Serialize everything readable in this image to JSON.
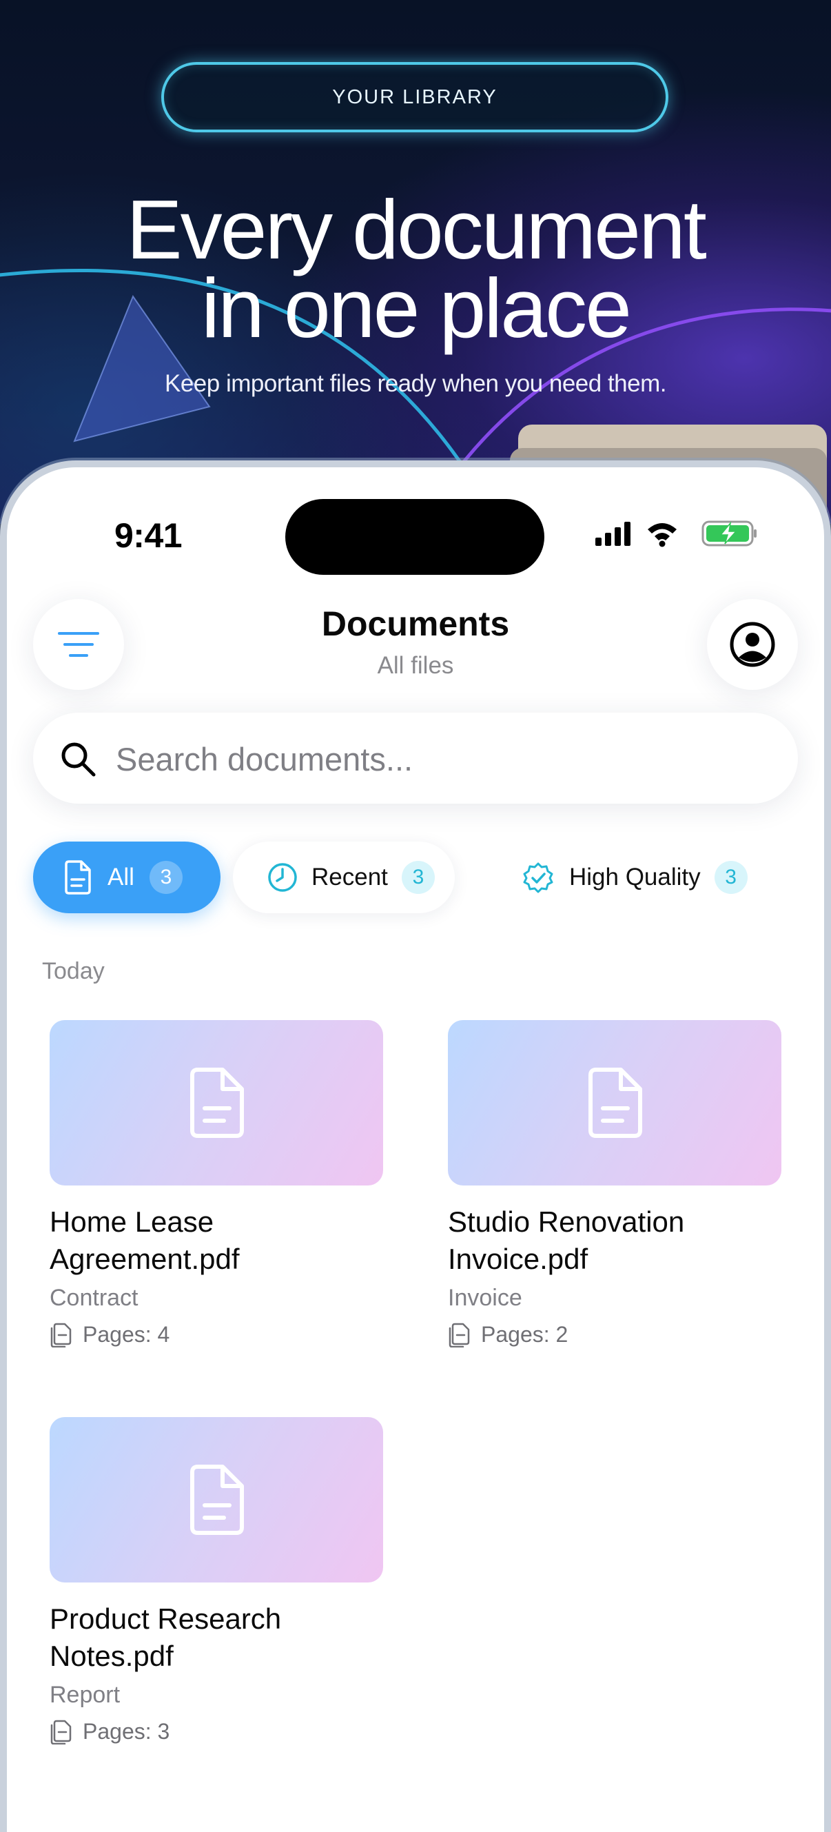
{
  "hero": {
    "badge": "YOUR LIBRARY",
    "title_line1": "Every document",
    "title_line2": "in one place",
    "subtitle": "Keep important files ready when you need them."
  },
  "status_bar": {
    "time": "9:41"
  },
  "header": {
    "title": "Documents",
    "subtitle": "All files",
    "menu_icon": "filter-lines-icon",
    "profile_icon": "user-circle-icon"
  },
  "search": {
    "placeholder": "Search documents...",
    "value": ""
  },
  "filters": [
    {
      "label": "All",
      "count": "3",
      "icon": "document-icon",
      "selected": true
    },
    {
      "label": "Recent",
      "count": "3",
      "icon": "clock-icon",
      "selected": false
    },
    {
      "label": "High Quality",
      "count": "3",
      "icon": "verified-badge-icon",
      "selected": false
    }
  ],
  "section": {
    "label": "Today"
  },
  "documents": [
    {
      "name": "Home Lease Agreement.pdf",
      "category": "Contract",
      "pages": "Pages: 4"
    },
    {
      "name": "Studio Renovation Invoice.pdf",
      "category": "Invoice",
      "pages": "Pages: 2"
    },
    {
      "name": "Product Research Notes.pdf",
      "category": "Report",
      "pages": "Pages: 3"
    }
  ],
  "colors": {
    "accent": "#3aa0f7",
    "teal": "#22b6d4",
    "hero_outline": "#4fc9e8"
  }
}
